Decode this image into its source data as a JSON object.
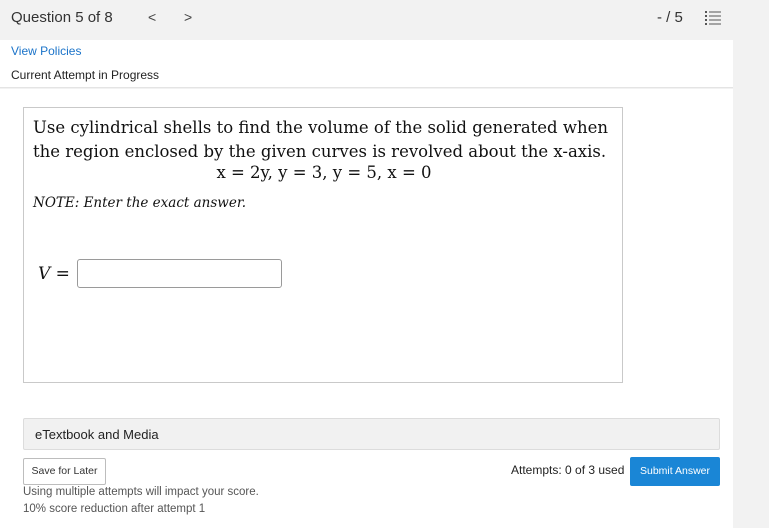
{
  "header": {
    "question_label": "Question 5 of 8",
    "prev_glyph": "<",
    "next_glyph": ">",
    "score": "- / 5",
    "list_icon": "list-icon"
  },
  "policies": {
    "link_label": "View Policies",
    "attempt_status": "Current Attempt in Progress"
  },
  "question": {
    "line1": "Use cylindrical shells to find the volume of the solid generated when",
    "line2": "the region enclosed by the given curves is revolved about the x-axis.",
    "equations": "x = 2y,  y = 3,  y = 5,  x = 0",
    "note": "NOTE: Enter the exact answer.",
    "answer_label": "V =",
    "answer_value": ""
  },
  "resources": {
    "label": "eTextbook and Media"
  },
  "actions": {
    "save_label": "Save for Later",
    "attempts_text": "Attempts: 0 of 3 used",
    "submit_label": "Submit Answer",
    "warning_1": "Using multiple attempts will impact your score.",
    "warning_2": "10% score reduction after attempt 1"
  },
  "colors": {
    "accent": "#1a86d6",
    "link": "#1a73c9"
  }
}
